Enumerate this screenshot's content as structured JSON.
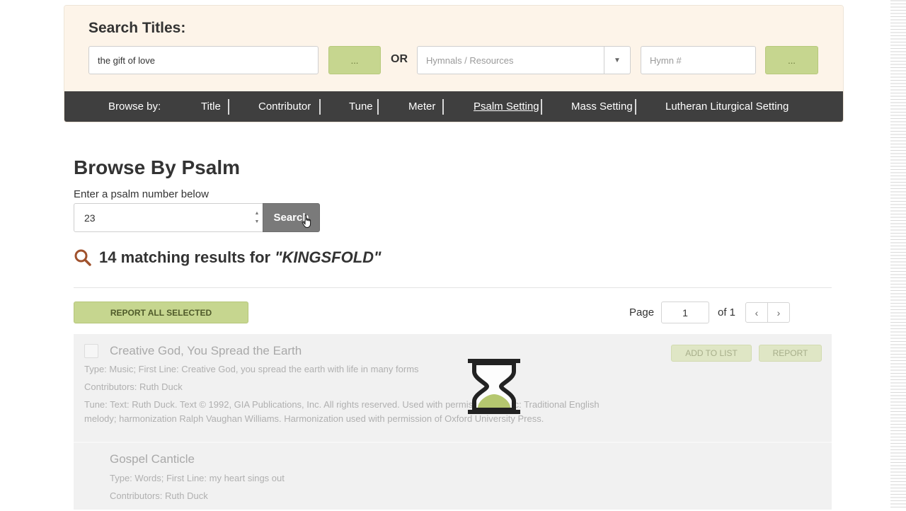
{
  "search": {
    "title": "Search Titles:",
    "title_query": "the gift of love",
    "title_button": "...",
    "or_label": "OR",
    "hymnal_placeholder": "Hymnals / Resources",
    "hymn_number_placeholder": "Hymn #",
    "hymn_button": "..."
  },
  "browse": {
    "label": "Browse by:",
    "items": [
      "Title",
      "Contributor",
      "Tune",
      "Meter",
      "Psalm Setting",
      "Mass Setting",
      "Lutheran Liturgical Setting"
    ],
    "active": "Psalm Setting"
  },
  "psalm": {
    "title": "Browse By Psalm",
    "hint": "Enter a psalm number below",
    "value": "23",
    "search_label": "Search"
  },
  "results": {
    "count_text": "14 matching results for ",
    "query_text": "\"KINGSFOLD\"",
    "report_all_label": "REPORT ALL SELECTED",
    "page_label": "Page",
    "page_value": "1",
    "of_label": "of 1",
    "items": [
      {
        "title": "Creative God, You Spread the Earth",
        "type_line": "Type: Music; First Line: Creative God, you spread the earth with life in many forms",
        "contributors": "Contributors: Ruth Duck",
        "tune_line_1": "Tune: Text: Ruth Duck. Text © 1992, GIA Publications, Inc. All rights reserved. Used with permission. Music: Traditional English",
        "tune_line_2": "melody; harmonization Ralph Vaughan Williams. Harmonization used with permission of Oxford University Press.",
        "add_to_list_label": "ADD TO LIST",
        "report_label": "REPORT"
      },
      {
        "title": "Gospel Canticle",
        "type_line": "Type: Words; First Line: my heart sings out",
        "contributors": "Contributors: Ruth Duck"
      }
    ]
  },
  "colors": {
    "accent_green": "#c6d68f",
    "nav_bar": "#3f3f3f",
    "panel_bg": "#fdf4e9",
    "search_icon": "#a0522d"
  },
  "icons": {
    "results_icon": "search-icon",
    "loading_icon": "hourglass-icon",
    "cursor": "hand-pointer-icon"
  }
}
